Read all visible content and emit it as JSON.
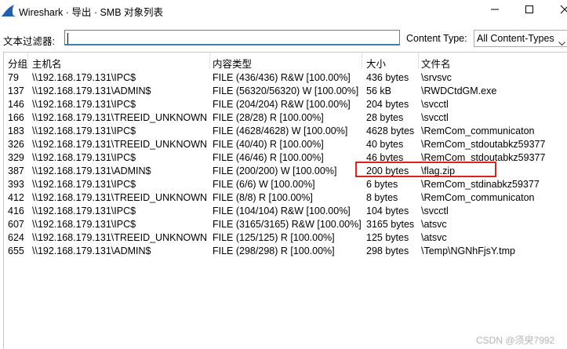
{
  "window": {
    "title": "Wireshark · 导出 · SMB 对象列表",
    "app_icon": "wireshark-fin-icon",
    "controls": [
      "minimize-icon",
      "maximize-icon",
      "close-icon"
    ]
  },
  "filter": {
    "label": "文本过滤器:",
    "value": "",
    "content_type_label": "Content Type:",
    "content_type_value": "All Content-Types"
  },
  "table": {
    "columns": [
      "分组",
      "主机名",
      "内容类型",
      "大小",
      "文件名"
    ],
    "rows": [
      {
        "packet": "79",
        "host": "\\\\192.168.179.131\\IPC$",
        "content": "FILE (436/436) R&W [100.00%]",
        "size": "436 bytes",
        "filename": "\\srvsvc"
      },
      {
        "packet": "137",
        "host": "\\\\192.168.179.131\\ADMIN$",
        "content": "FILE (56320/56320) W [100.00%]",
        "size": "56 kB",
        "filename": "\\RWDCtdGM.exe"
      },
      {
        "packet": "146",
        "host": "\\\\192.168.179.131\\IPC$",
        "content": "FILE (204/204) R&W [100.00%]",
        "size": "204 bytes",
        "filename": "\\svcctl"
      },
      {
        "packet": "166",
        "host": "\\\\192.168.179.131\\TREEID_UNKNOWN",
        "content": "FILE (28/28) R [100.00%]",
        "size": "28 bytes",
        "filename": "\\svcctl"
      },
      {
        "packet": "183",
        "host": "\\\\192.168.179.131\\IPC$",
        "content": "FILE (4628/4628) W [100.00%]",
        "size": "4628 bytes",
        "filename": "\\RemCom_communicaton"
      },
      {
        "packet": "326",
        "host": "\\\\192.168.179.131\\TREEID_UNKNOWN",
        "content": "FILE (40/40) R [100.00%]",
        "size": "40 bytes",
        "filename": "\\RemCom_stdoutabkz59377"
      },
      {
        "packet": "329",
        "host": "\\\\192.168.179.131\\IPC$",
        "content": "FILE (46/46) R [100.00%]",
        "size": "46 bytes",
        "filename": "\\RemCom_stdoutabkz59377"
      },
      {
        "packet": "387",
        "host": "\\\\192.168.179.131\\ADMIN$",
        "content": "FILE (200/200) W [100.00%]",
        "size": "200 bytes",
        "filename": "\\flag.zip"
      },
      {
        "packet": "393",
        "host": "\\\\192.168.179.131\\IPC$",
        "content": "FILE (6/6) W [100.00%]",
        "size": "6 bytes",
        "filename": "\\RemCom_stdinabkz59377"
      },
      {
        "packet": "412",
        "host": "\\\\192.168.179.131\\TREEID_UNKNOWN",
        "content": "FILE (8/8) R [100.00%]",
        "size": "8 bytes",
        "filename": "\\RemCom_communicaton"
      },
      {
        "packet": "416",
        "host": "\\\\192.168.179.131\\IPC$",
        "content": "FILE (104/104) R&W [100.00%]",
        "size": "104 bytes",
        "filename": "\\svcctl"
      },
      {
        "packet": "607",
        "host": "\\\\192.168.179.131\\IPC$",
        "content": "FILE (3165/3165) R&W [100.00%]",
        "size": "3165 bytes",
        "filename": "\\atsvc"
      },
      {
        "packet": "624",
        "host": "\\\\192.168.179.131\\TREEID_UNKNOWN",
        "content": "FILE (125/125) R [100.00%]",
        "size": "125 bytes",
        "filename": "\\atsvc"
      },
      {
        "packet": "655",
        "host": "\\\\192.168.179.131\\ADMIN$",
        "content": "FILE (298/298) R [100.00%]",
        "size": "298 bytes",
        "filename": "\\Temp\\NGNhFjsY.tmp"
      }
    ]
  },
  "annotation": {
    "highlight_color": "#e0211b",
    "highlighted_row_packet": "387"
  },
  "watermark": "CSDN @须臾7992"
}
